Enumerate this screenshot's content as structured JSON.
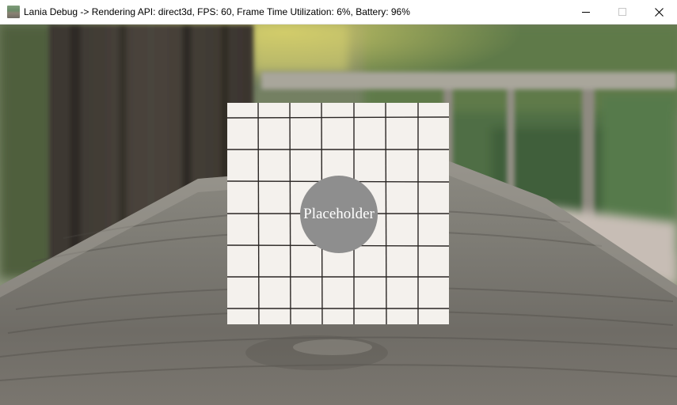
{
  "window": {
    "title": "Lania Debug -> Rendering API: direct3d, FPS: 60, Frame Time Utilization: 6%, Battery: 96%",
    "icon": "app-icon",
    "controls": [
      "minimize-icon",
      "maximize-icon",
      "close-icon"
    ]
  },
  "scene": {
    "background": "blurred-wooden-railing-photo",
    "tile": {
      "pattern": "grid-tiles",
      "label": "Placeholder",
      "label_color": "#ffffff",
      "circle_color": "#8e8e8e"
    }
  }
}
